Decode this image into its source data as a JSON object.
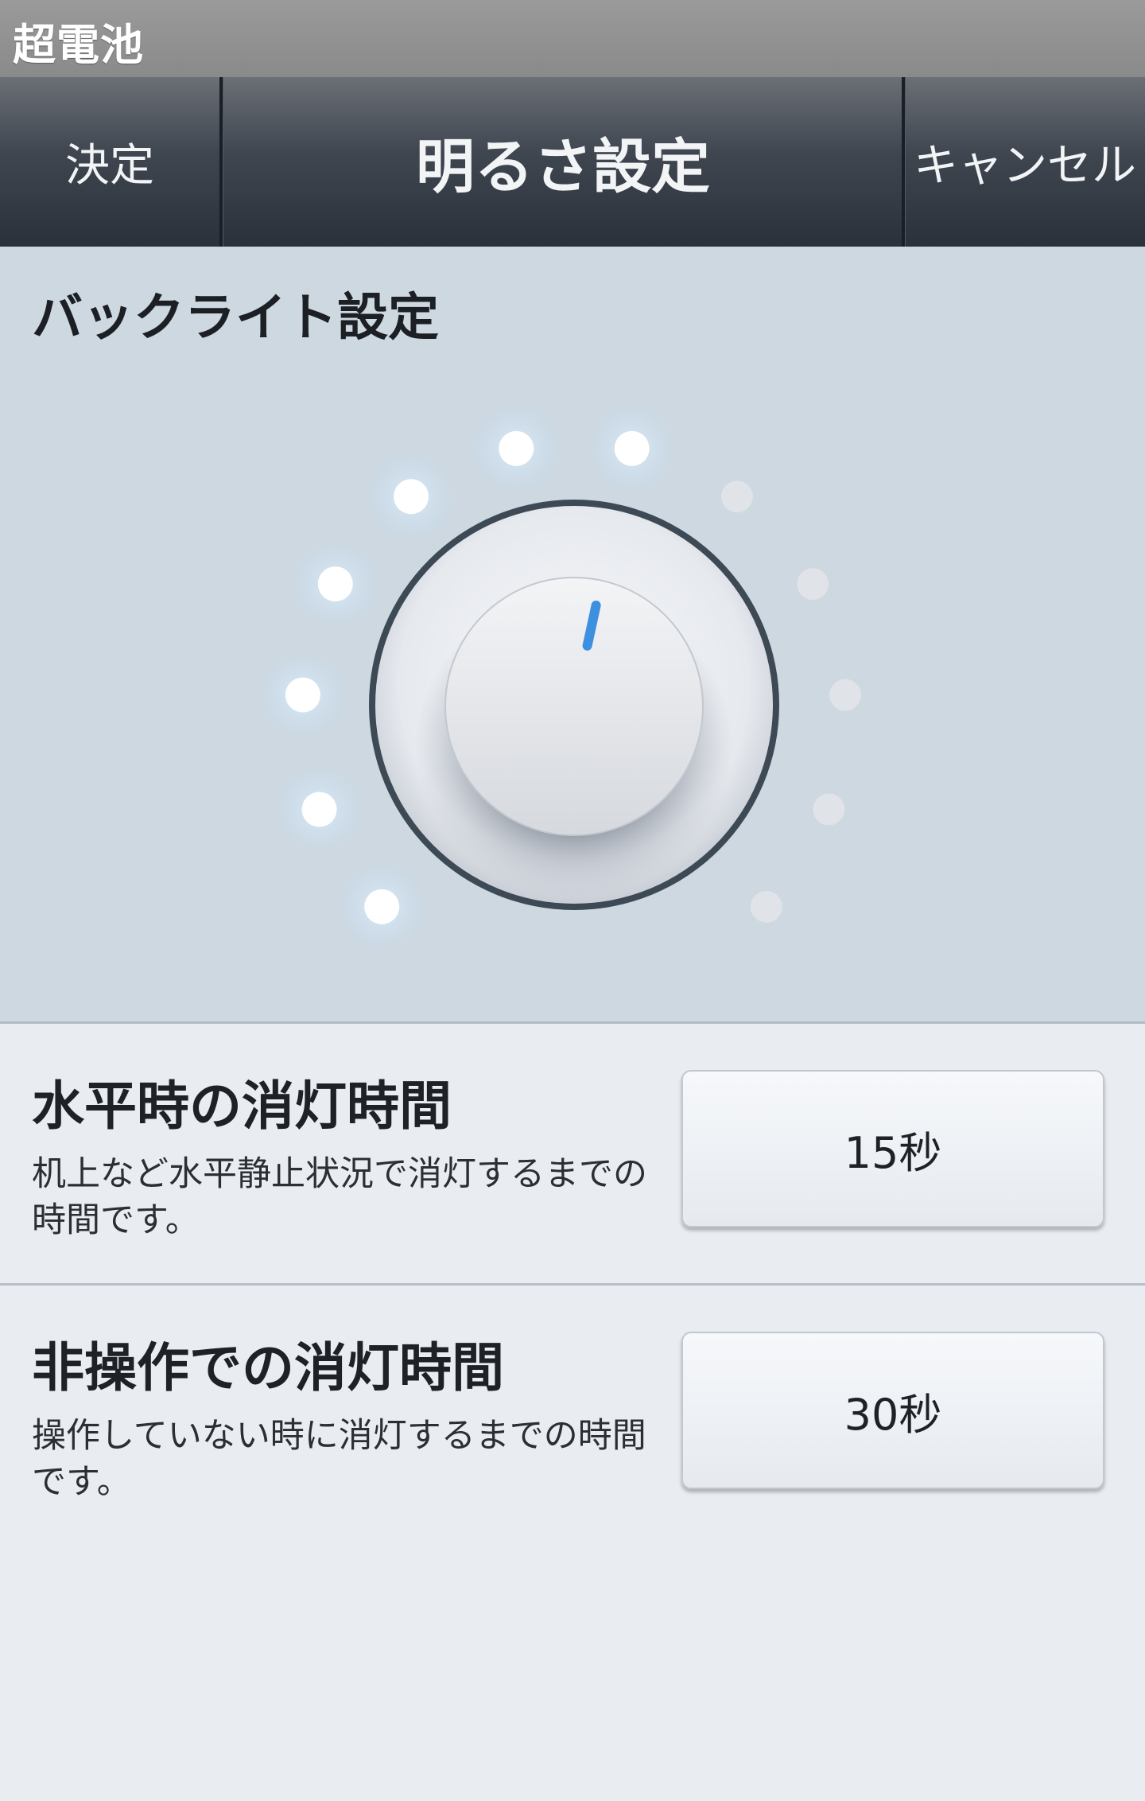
{
  "app": {
    "title": "超電池"
  },
  "toolbar": {
    "ok_label": "決定",
    "title": "明るさ設定",
    "cancel_label": "キャンセル"
  },
  "backlight": {
    "title": "バックライト設定",
    "level": 7,
    "max_level": 12,
    "indicator_color": "#3d8fe0",
    "lit_color": "#ffffff",
    "unlit_color": "#e0e3e7"
  },
  "settings": [
    {
      "label": "水平時の消灯時間",
      "description": "机上など水平静止状況で消灯するまでの時間です。",
      "value": "15秒"
    },
    {
      "label": "非操作での消灯時間",
      "description": "操作していない時に消灯するまでの時間です。",
      "value": "30秒"
    }
  ]
}
